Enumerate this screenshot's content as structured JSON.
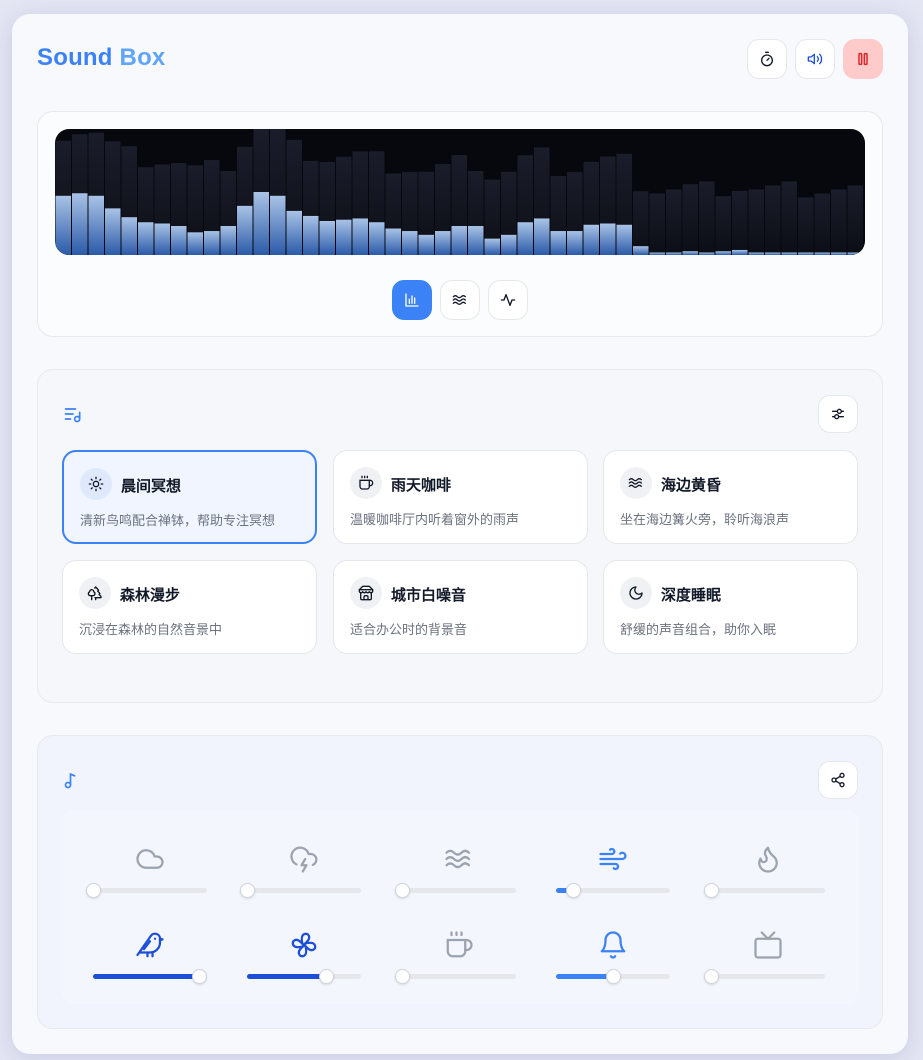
{
  "app": {
    "title_part1": "Sound",
    "title_part2": "Box"
  },
  "header": {
    "timer_icon": "stopwatch-icon",
    "volume_icon": "speaker-icon",
    "pause_icon": "pause-icon"
  },
  "visualizer": {
    "modes": [
      {
        "icon": "bar-chart-icon",
        "active": true
      },
      {
        "icon": "waves-icon",
        "active": false
      },
      {
        "icon": "activity-icon",
        "active": false
      }
    ],
    "bar_levels": [
      0.47,
      0.49,
      0.47,
      0.37,
      0.3,
      0.26,
      0.25,
      0.23,
      0.18,
      0.19,
      0.23,
      0.39,
      0.5,
      0.47,
      0.35,
      0.31,
      0.27,
      0.28,
      0.29,
      0.26,
      0.21,
      0.19,
      0.16,
      0.19,
      0.23,
      0.23,
      0.13,
      0.16,
      0.26,
      0.29,
      0.19,
      0.19,
      0.24,
      0.25,
      0.24,
      0.07,
      0.02,
      0.02,
      0.03,
      0.02,
      0.03,
      0.04,
      0.02,
      0.02,
      0.02,
      0.02,
      0.02,
      0.02,
      0.02
    ]
  },
  "presets": {
    "section_icon": "playlist-icon",
    "settings_icon": "sliders-icon",
    "items": [
      {
        "name": "晨间冥想",
        "desc": "清新鸟鸣配合禅钵，帮助专注冥想",
        "icon": "sun-icon",
        "active": true
      },
      {
        "name": "雨天咖啡",
        "desc": "温暖咖啡厅内听着窗外的雨声",
        "icon": "coffee-icon",
        "active": false
      },
      {
        "name": "海边黄昏",
        "desc": "坐在海边篝火旁，聆听海浪声",
        "icon": "waves-icon",
        "active": false
      },
      {
        "name": "森林漫步",
        "desc": "沉浸在森林的自然音景中",
        "icon": "trees-icon",
        "active": false
      },
      {
        "name": "城市白噪音",
        "desc": "适合办公时的背景音",
        "icon": "store-icon",
        "active": false
      },
      {
        "name": "深度睡眠",
        "desc": "舒缓的声音组合，助你入眠",
        "icon": "moon-icon",
        "active": false
      }
    ]
  },
  "mixer": {
    "section_icon": "music-note-icon",
    "share_icon": "share-icon",
    "channels": [
      {
        "icon": "cloud-icon",
        "level": 0,
        "active": false
      },
      {
        "icon": "cloud-lightning-icon",
        "level": 0,
        "active": false
      },
      {
        "icon": "waves-icon",
        "level": 0,
        "active": false
      },
      {
        "icon": "wind-icon",
        "level": 0.15,
        "active": true
      },
      {
        "icon": "flame-icon",
        "level": 0,
        "active": false
      },
      {
        "icon": "bird-icon",
        "level": 0.93,
        "active": true
      },
      {
        "icon": "fan-icon",
        "level": 0.7,
        "active": true
      },
      {
        "icon": "coffee-icon",
        "level": 0,
        "active": false
      },
      {
        "icon": "bell-icon",
        "level": 0.5,
        "active": true
      },
      {
        "icon": "tv-icon",
        "level": 0,
        "active": false
      }
    ]
  },
  "colors": {
    "accent": "#3b82f6",
    "accent_dark": "#1d4ed8",
    "pause_bg": "#fecaca",
    "pause_icon": "#dc2626",
    "inactive_icon": "#9ca3af"
  }
}
